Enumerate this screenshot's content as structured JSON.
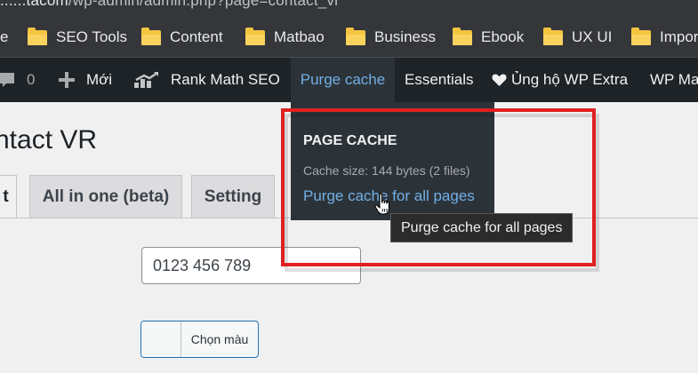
{
  "browser": {
    "url_host": "......tacom",
    "url_path": "/wp-admin/admin.php?page=contact_vr"
  },
  "bookmarks": {
    "partial_first": "e",
    "items": [
      {
        "label": "SEO Tools"
      },
      {
        "label": "Content"
      },
      {
        "label": "Matbao"
      },
      {
        "label": "Business"
      },
      {
        "label": "Ebook"
      },
      {
        "label": "UX UI"
      },
      {
        "label": "Impor"
      }
    ]
  },
  "adminbar": {
    "comments_count": "0",
    "new_label": "Mới",
    "rankmath_label": "Rank Math SEO",
    "purge_label": "Purge cache",
    "essentials_label": "Essentials",
    "donate_label": "Ủng hộ WP Extra",
    "wpma_label": "WP Ma"
  },
  "dropdown": {
    "heading": "PAGE CACHE",
    "cache_size": "Cache size: 144 bytes (2 files)",
    "purge_all_label": "Purge cache for all pages"
  },
  "tooltip": {
    "text": "Purge cache for all pages"
  },
  "page": {
    "title": "ntact VR",
    "tabs": [
      {
        "label": "t"
      },
      {
        "label": "All in one (beta)"
      },
      {
        "label": "Setting"
      }
    ],
    "phone_value": "0123 456 789",
    "color_button_label": "Chọn màu"
  },
  "colors": {
    "adminbar_bg": "#1d2327",
    "dropdown_bg": "#2c3338",
    "link_blue": "#72aee6",
    "highlight_red": "#e02020",
    "folder_yellow": "#f5c542"
  },
  "icons": [
    "folder-icon",
    "comment-icon",
    "plus-icon",
    "rank-math-icon",
    "heart-icon",
    "hand-pointer-cursor-icon"
  ]
}
